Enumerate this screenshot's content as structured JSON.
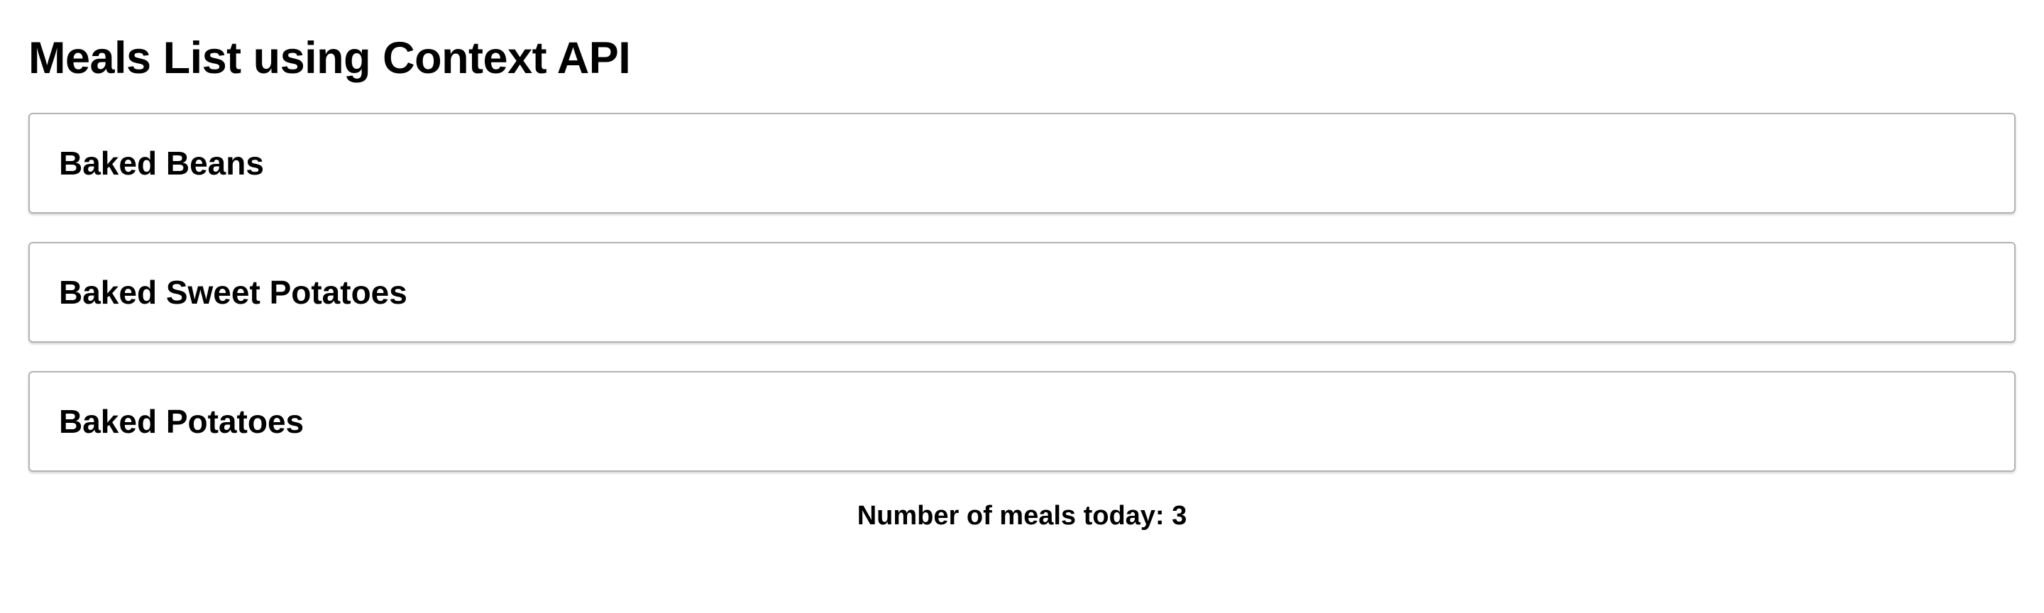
{
  "page": {
    "title": "Meals List using Context API"
  },
  "meals": [
    {
      "name": "Baked Beans"
    },
    {
      "name": "Baked Sweet Potatoes"
    },
    {
      "name": "Baked Potatoes"
    }
  ],
  "footer": {
    "count_label": "Number of meals today: 3"
  }
}
